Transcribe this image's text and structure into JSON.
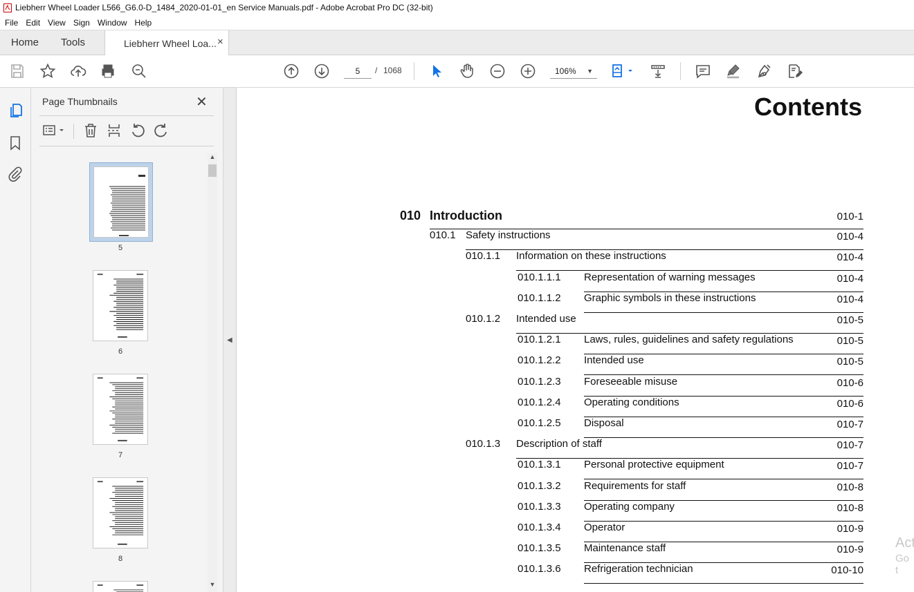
{
  "window": {
    "title": "Liebherr Wheel Loader L566_G6.0-D_1484_2020-01-01_en Service Manuals.pdf - Adobe Acrobat Pro DC (32-bit)"
  },
  "menu": [
    "File",
    "Edit",
    "View",
    "Sign",
    "Window",
    "Help"
  ],
  "tabs": {
    "home": "Home",
    "tools": "Tools",
    "document": "Liebherr Wheel Loa...",
    "close": "×"
  },
  "toolbar": {
    "page_current": "5",
    "page_separator": "/",
    "page_total": "1068",
    "zoom": "106%"
  },
  "panel": {
    "title": "Page Thumbnails",
    "close": "✕",
    "thumbnails": [
      {
        "label": "5",
        "selected": true
      },
      {
        "label": "6",
        "selected": false
      },
      {
        "label": "7",
        "selected": false
      },
      {
        "label": "8",
        "selected": false
      }
    ]
  },
  "document": {
    "heading": "Contents",
    "toc": [
      {
        "num": "010",
        "text": "Introduction",
        "page": "010-1",
        "level": 0
      },
      {
        "num": "010.1",
        "text": "Safety instructions",
        "page": "010-4",
        "level": 1
      },
      {
        "num": "010.1.1",
        "text": "Information on these instructions",
        "page": "010-4",
        "level": 2
      },
      {
        "num": "010.1.1.1",
        "text": "Representation of warning messages",
        "page": "010-4",
        "level": 3
      },
      {
        "num": "010.1.1.2",
        "text": "Graphic symbols in these instructions",
        "page": "010-4",
        "level": 3
      },
      {
        "num": "010.1.2",
        "text": "Intended use",
        "page": "010-5",
        "level": 2
      },
      {
        "num": "010.1.2.1",
        "text": "Laws, rules, guidelines and safety regulations",
        "page": "010-5",
        "level": 3
      },
      {
        "num": "010.1.2.2",
        "text": "Intended use",
        "page": "010-5",
        "level": 3
      },
      {
        "num": "010.1.2.3",
        "text": "Foreseeable misuse",
        "page": "010-6",
        "level": 3
      },
      {
        "num": "010.1.2.4",
        "text": "Operating conditions",
        "page": "010-6",
        "level": 3
      },
      {
        "num": "010.1.2.5",
        "text": "Disposal",
        "page": "010-7",
        "level": 3
      },
      {
        "num": "010.1.3",
        "text": "Description of staff",
        "page": "010-7",
        "level": 2
      },
      {
        "num": "010.1.3.1",
        "text": "Personal protective equipment",
        "page": "010-7",
        "level": 3
      },
      {
        "num": "010.1.3.2",
        "text": "Requirements for staff",
        "page": "010-8",
        "level": 3
      },
      {
        "num": "010.1.3.3",
        "text": "Operating company",
        "page": "010-8",
        "level": 3
      },
      {
        "num": "010.1.3.4",
        "text": "Operator",
        "page": "010-9",
        "level": 3
      },
      {
        "num": "010.1.3.5",
        "text": "Maintenance staff",
        "page": "010-9",
        "level": 3
      },
      {
        "num": "010.1.3.6",
        "text": "Refrigeration technician",
        "page": "010-10",
        "level": 3
      }
    ],
    "watermark_line1": "Act",
    "watermark_line2": "Go t"
  },
  "colors": {
    "accent": "#1473e6",
    "toolbar_icon": "#555555"
  }
}
